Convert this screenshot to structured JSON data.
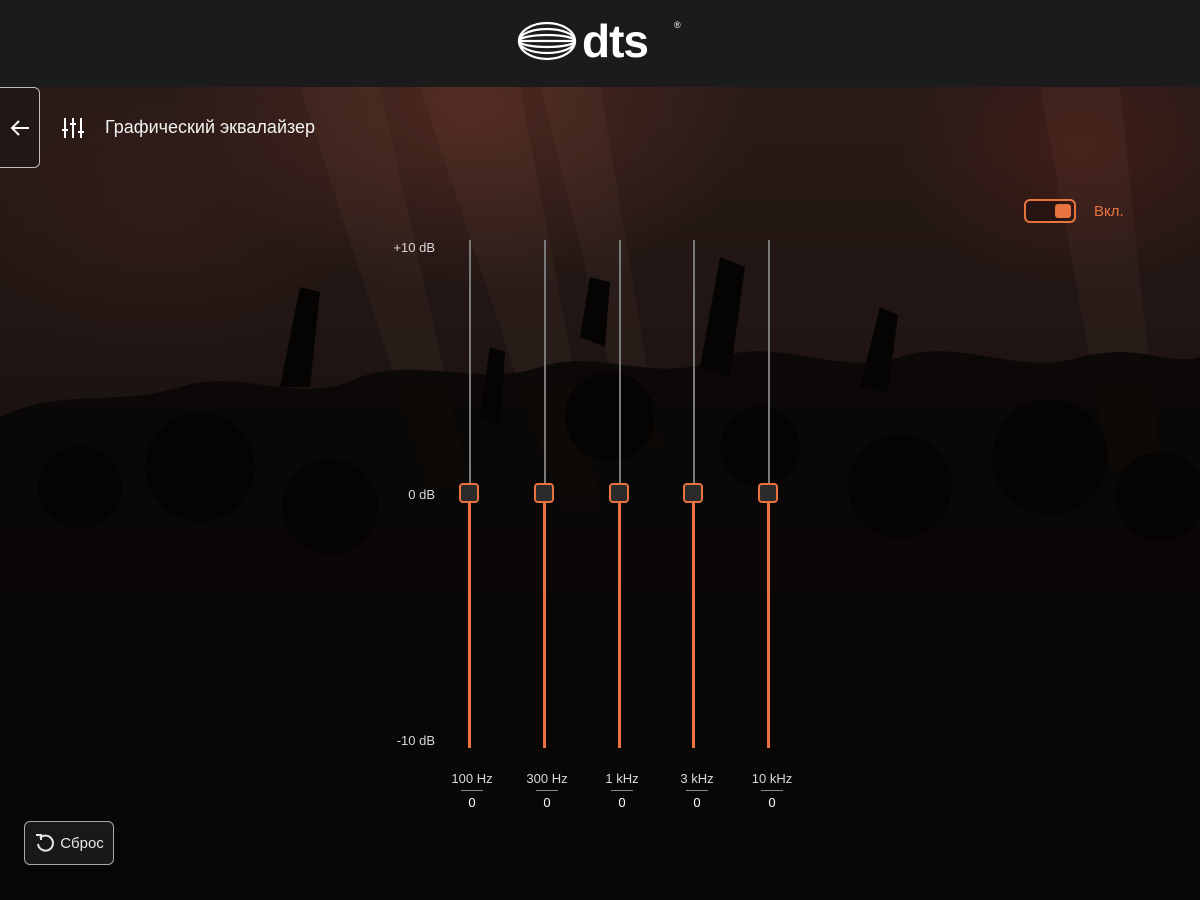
{
  "header": {
    "brand": "dts",
    "registered": "®"
  },
  "nav": {
    "back_icon": "arrow-left-icon",
    "page_icon": "equalizer-sliders-icon"
  },
  "page": {
    "title": "Графический эквалайзер"
  },
  "toggle": {
    "label": "Вкл.",
    "on": true
  },
  "scale": {
    "top": "+10 dB",
    "middle": "0 dB",
    "bottom": "-10 dB",
    "min": -10,
    "max": 10
  },
  "bands": [
    {
      "freq": "100 Hz",
      "value": "0",
      "db": 0
    },
    {
      "freq": "300 Hz",
      "value": "0",
      "db": 0
    },
    {
      "freq": "1 kHz",
      "value": "0",
      "db": 0
    },
    {
      "freq": "3 kHz",
      "value": "0",
      "db": 0
    },
    {
      "freq": "10 kHz",
      "value": "0",
      "db": 0
    }
  ],
  "reset": {
    "label": "Сброс",
    "icon": "reset-icon"
  },
  "colors": {
    "accent": "#e8733f",
    "header_bg": "#1b1b1b",
    "track_upper": "#7a7a7a"
  }
}
